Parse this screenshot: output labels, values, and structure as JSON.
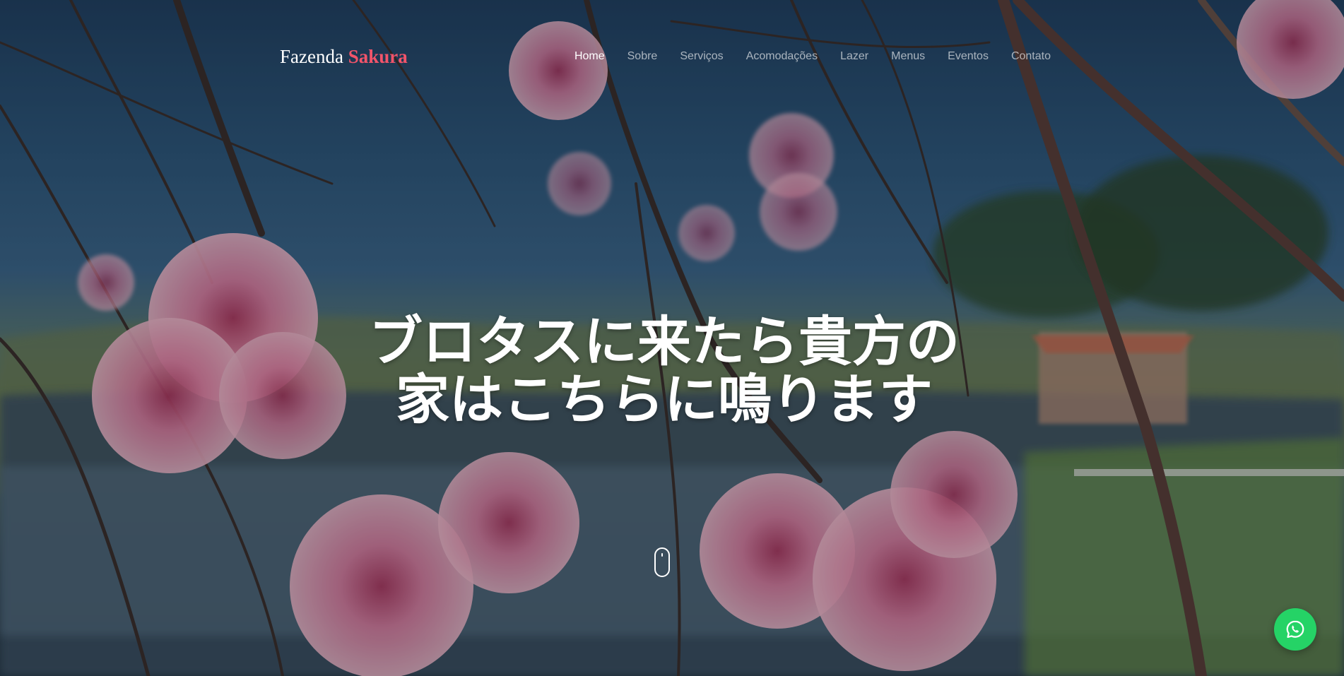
{
  "brand": {
    "name_part1": "Fazenda",
    "name_part2": "Sakura",
    "accent_color": "#f2546a"
  },
  "nav": {
    "items": [
      {
        "label": "Home",
        "active": true
      },
      {
        "label": "Sobre",
        "active": false
      },
      {
        "label": "Serviços",
        "active": false
      },
      {
        "label": "Acomodações",
        "active": false
      },
      {
        "label": "Lazer",
        "active": false
      },
      {
        "label": "Menus",
        "active": false
      },
      {
        "label": "Eventos",
        "active": false
      },
      {
        "label": "Contato",
        "active": false
      }
    ]
  },
  "hero": {
    "headline_line1": "ブロタスに来たら貴方の",
    "headline_line2": "家はこちらに鳴ります",
    "background_image": "cherry-blossom-branches-over-lake-and-farm",
    "scroll_icon": "mouse-scroll-icon"
  },
  "floating": {
    "whatsapp_icon": "whatsapp-icon",
    "whatsapp_color": "#25d366"
  }
}
